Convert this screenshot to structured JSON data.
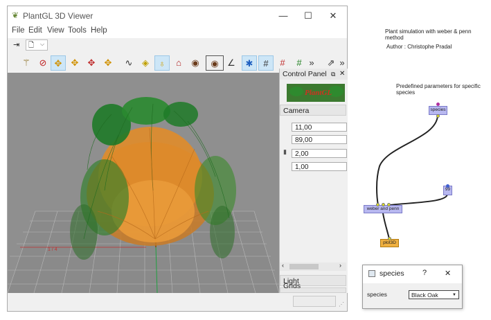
{
  "viewer": {
    "title": "PlantGL 3D Viewer",
    "menu": [
      "File",
      "Edit",
      "View",
      "Tools",
      "Help"
    ],
    "logo_text": "PlantGL",
    "control_panel": {
      "title": "Control Panel",
      "camera_label": "Camera",
      "fields": [
        "11,00",
        "89,00",
        "2,00",
        "1,00"
      ],
      "light_label": "Light",
      "grids_label": "Grids"
    },
    "axis_label": "1 / 4"
  },
  "graph": {
    "header_title": "Plant simulation with weber & penn method",
    "author": "Author : Christophe Pradal",
    "section": "Predefined parameters for specific species",
    "nodes": {
      "species": "species",
      "value": "99",
      "weber": "weber and penn",
      "plot": "plot3D"
    }
  },
  "dialog": {
    "title": "species",
    "help": "?",
    "close": "✕",
    "field_label": "species",
    "selected_value": "Black Oak"
  },
  "colors": {
    "node_fill": "#b8b8f0",
    "plot_node_fill": "#f0b040",
    "foliage_dark": "#1e7a28",
    "foliage_orange": "#e08c2a"
  }
}
